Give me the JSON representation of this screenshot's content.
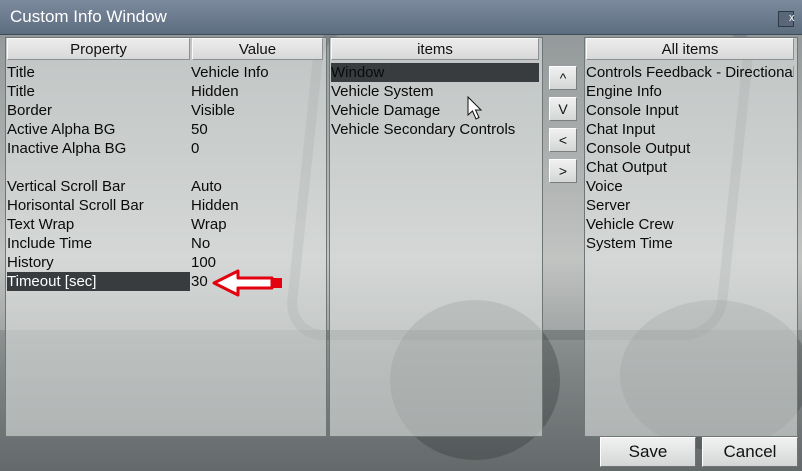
{
  "window": {
    "title": "Custom Info Window",
    "close_label": "x"
  },
  "properties": {
    "header_property": "Property",
    "header_value": "Value",
    "rows": [
      {
        "name": "Title",
        "value": "Vehicle Info"
      },
      {
        "name": "Title",
        "value": "Hidden"
      },
      {
        "name": "Border",
        "value": "Visible"
      },
      {
        "name": "Active Alpha BG",
        "value": "50"
      },
      {
        "name": "Inactive Alpha BG",
        "value": "0"
      },
      {
        "name": "",
        "value": ""
      },
      {
        "name": "Vertical Scroll Bar",
        "value": "Auto"
      },
      {
        "name": "Horisontal Scroll Bar",
        "value": "Hidden"
      },
      {
        "name": "Text Wrap",
        "value": "Wrap"
      },
      {
        "name": "Include Time",
        "value": "No"
      },
      {
        "name": "History",
        "value": "100"
      },
      {
        "name": "Timeout [sec]",
        "value": "30"
      }
    ]
  },
  "items_list": {
    "header": "items",
    "entries": [
      "Window",
      "Vehicle System",
      "Vehicle Damage",
      "Vehicle Secondary Controls"
    ]
  },
  "move_buttons": {
    "up": "^",
    "down": "V",
    "left": "<",
    "right": ">"
  },
  "all_items": {
    "header": "All items",
    "entries": [
      "Controls Feedback - Directional",
      "Engine Info",
      "Console Input",
      "Chat Input",
      "Console Output",
      "Chat Output",
      "Voice",
      "Server",
      "Vehicle Crew",
      "System Time"
    ]
  },
  "footer": {
    "save": "Save",
    "cancel": "Cancel"
  },
  "colors": {
    "arrow": "#e3000f",
    "titlebar": "#66768a",
    "selection": "#383c3e"
  }
}
